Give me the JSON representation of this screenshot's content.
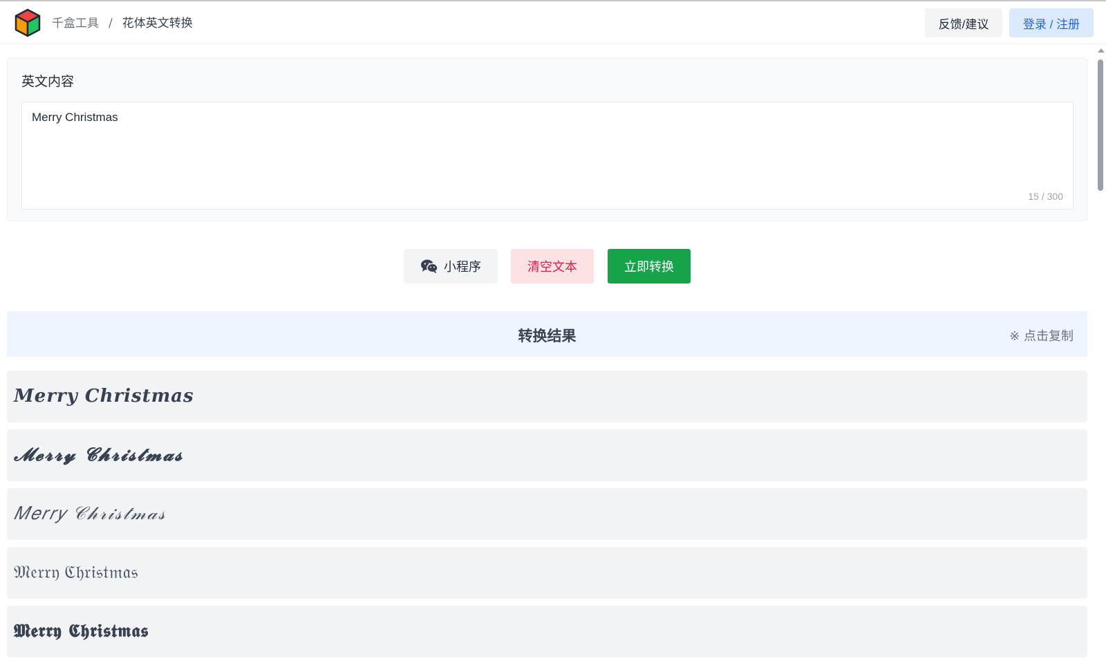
{
  "header": {
    "breadcrumb_home": "千盒工具",
    "breadcrumb_sep": "/",
    "breadcrumb_current": "花体英文转换",
    "feedback_label": "反馈/建议",
    "login_label": "登录 / 注册"
  },
  "input": {
    "label": "英文内容",
    "value": "Merry Christmas",
    "counter": "15 / 300"
  },
  "actions": {
    "miniprogram_label": "小程序",
    "miniprogram_icon": "wechat-icon",
    "clear_label": "清空文本",
    "convert_label": "立即转换"
  },
  "results": {
    "title": "转换结果",
    "copy_hint": "※ 点击复制",
    "items": [
      "𝑴𝒆𝒓𝒓𝒚 𝑪𝒉𝒓𝒊𝒔𝒕𝒎𝒂𝒔",
      "𝓜𝓮𝓻𝓻𝔂 𝓒𝓱𝓻𝓲𝓼𝓽𝓶𝓪𝓼",
      "𝑀𝑒𝑟𝑟𝑦 𝒞𝒽𝓇𝒾𝓈𝓉𝓂𝒶𝓈",
      "𝔐𝔢𝔯𝔯𝔶 ℭ𝔥𝔯𝔦𝔰𝔱𝔪𝔞𝔰",
      "𝕸𝖊𝖗𝖗𝖞 𝕮𝖍𝖗𝖎𝖘𝖙𝖒𝖆𝖘"
    ]
  },
  "colors": {
    "convert_bg": "#16a34a",
    "clear_text": "#e11d48",
    "login_text": "#2563eb",
    "result_header_bg": "#eef5ff"
  }
}
